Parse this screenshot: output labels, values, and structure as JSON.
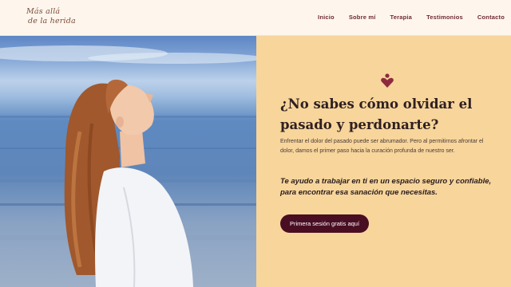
{
  "brand": {
    "logo_line1": "Más allá",
    "logo_line2": "de la herida"
  },
  "nav": {
    "items": [
      "Inicio",
      "Sobre mí",
      "Terapia",
      "Testimonios",
      "Contacto"
    ]
  },
  "hero": {
    "title": "¿No sabes cómo olvidar el pasado y perdonarte?",
    "description": "Enfrentar el dolor del pasado puede ser abrumador. Pero al permitirnos afrontar el dolor, damos el primer paso hacia la curación profunda de nuestro ser.",
    "emphasis": "Te ayudo a trabajar en ti en un espacio seguro y confiable, para encontrar esa sanación que necesitas.",
    "cta_label": "Primera sesión gratis aquí",
    "icon": "heart-person-icon"
  },
  "colors": {
    "header_bg": "#fef6ec",
    "panel_bg": "#f7d59b",
    "nav_text": "#6e2a35",
    "heading_text": "#2f2021",
    "cta_bg": "#4a0e22",
    "heart_accent": "#8e2a3e"
  }
}
